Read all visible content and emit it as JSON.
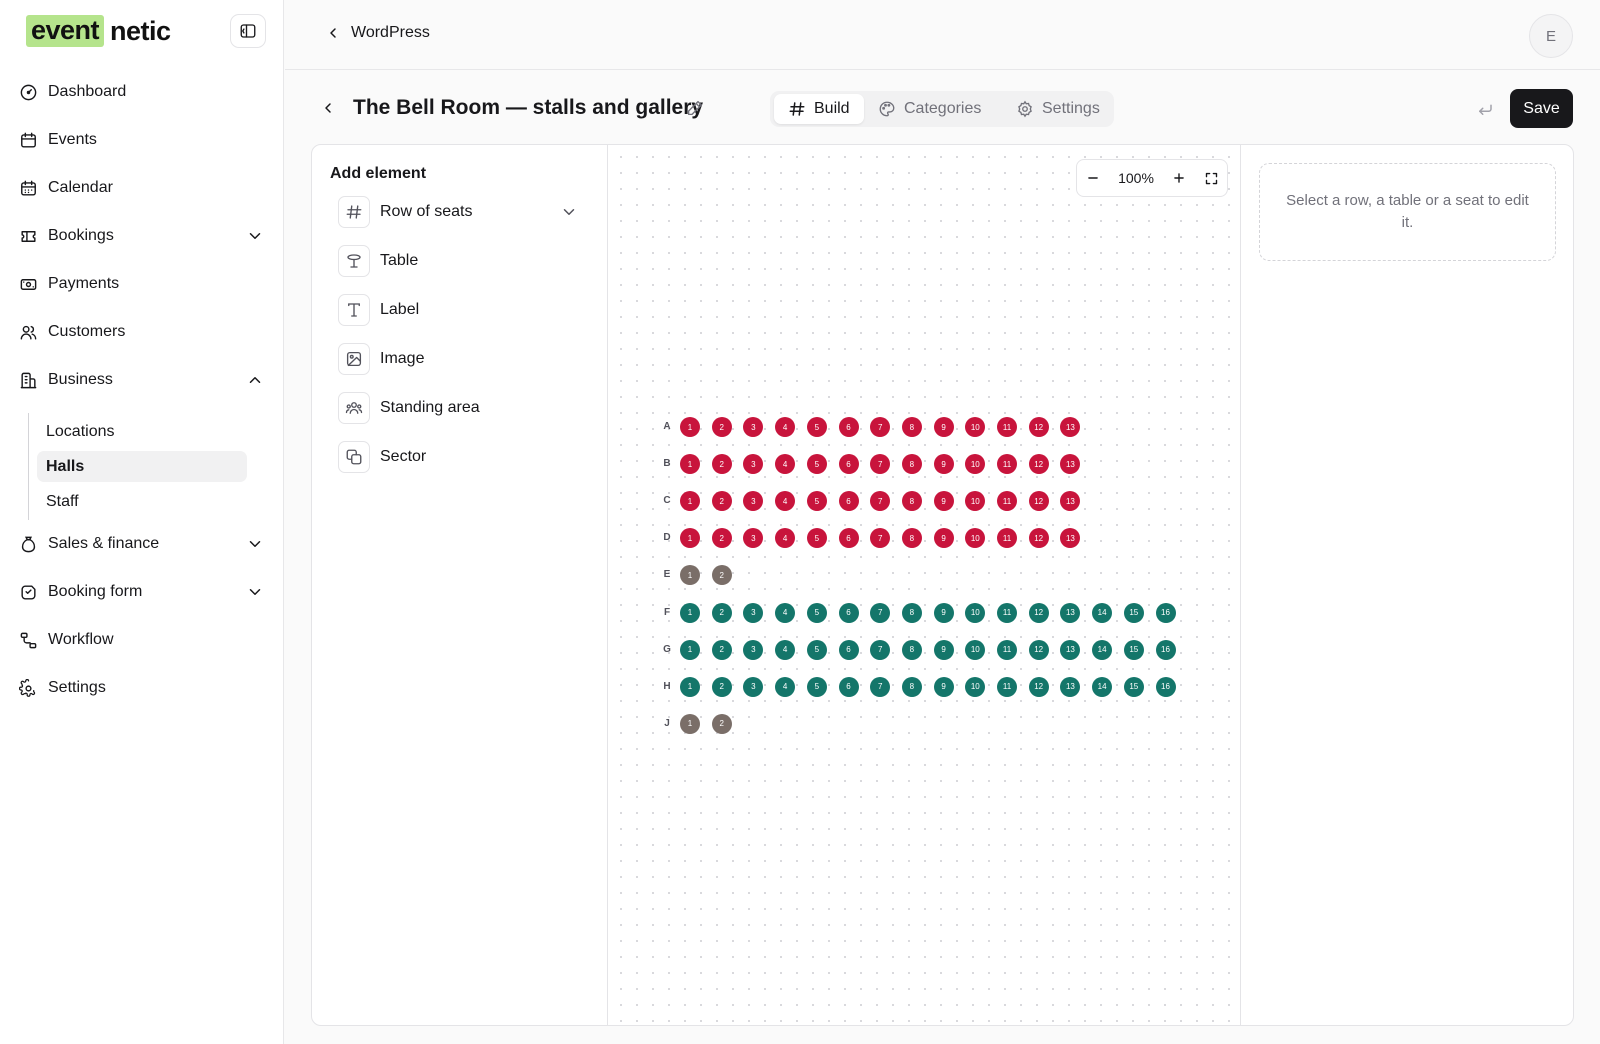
{
  "app": {
    "logo_part1": "event",
    "logo_part2": "netic"
  },
  "sidebar": {
    "items": [
      {
        "label": "Dashboard"
      },
      {
        "label": "Events"
      },
      {
        "label": "Calendar"
      },
      {
        "label": "Bookings"
      },
      {
        "label": "Payments"
      },
      {
        "label": "Customers"
      },
      {
        "label": "Business"
      },
      {
        "label": "Sales & finance"
      },
      {
        "label": "Booking form"
      },
      {
        "label": "Workflow"
      },
      {
        "label": "Settings"
      }
    ],
    "business_sub": [
      {
        "label": "Locations"
      },
      {
        "label": "Halls",
        "active": true
      },
      {
        "label": "Staff"
      }
    ]
  },
  "topbar": {
    "back_label": "WordPress",
    "avatar_initial": "E"
  },
  "header": {
    "title": "The Bell Room — stalls and gallery",
    "tabs": [
      {
        "label": "Build"
      },
      {
        "label": "Categories"
      },
      {
        "label": "Settings"
      }
    ],
    "active_tab": "Build",
    "save_label": "Save"
  },
  "add_element": {
    "title": "Add element",
    "items": [
      {
        "label": "Row of seats",
        "icon": "hash-icon"
      },
      {
        "label": "Table",
        "icon": "table-icon"
      },
      {
        "label": "Label",
        "icon": "text-icon"
      },
      {
        "label": "Image",
        "icon": "image-icon"
      },
      {
        "label": "Standing area",
        "icon": "people-icon"
      },
      {
        "label": "Sector",
        "icon": "layers-icon"
      }
    ]
  },
  "canvas": {
    "zoom": "100%",
    "seat_colors": {
      "stalls": "#c8143c",
      "gallery": "#14766a",
      "unassigned": "#7a6e68"
    },
    "rows": [
      {
        "label": "A",
        "seats": 13,
        "category": "stalls"
      },
      {
        "label": "B",
        "seats": 13,
        "category": "stalls"
      },
      {
        "label": "C",
        "seats": 13,
        "category": "stalls"
      },
      {
        "label": "D",
        "seats": 13,
        "category": "stalls"
      },
      {
        "label": "E",
        "seats": 2,
        "category": "unassigned"
      },
      {
        "label": "F",
        "seats": 16,
        "category": "gallery"
      },
      {
        "label": "G",
        "seats": 16,
        "category": "gallery"
      },
      {
        "label": "H",
        "seats": 16,
        "category": "gallery"
      },
      {
        "label": "J",
        "seats": 2,
        "category": "unassigned"
      }
    ]
  },
  "inspector": {
    "hint": "Select a row, a table or a seat to edit it."
  }
}
